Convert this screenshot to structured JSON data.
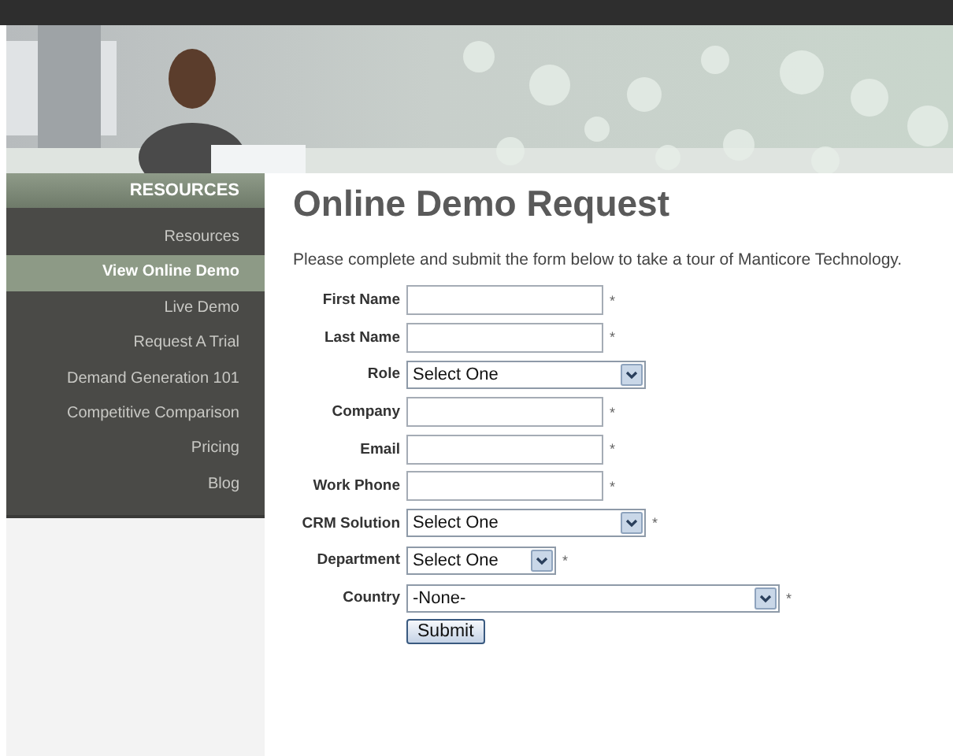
{
  "sidebar": {
    "heading": "RESOURCES",
    "items": [
      {
        "label": "Resources",
        "selected": false
      },
      {
        "label": "View Online Demo",
        "selected": true
      },
      {
        "label": "Live Demo",
        "selected": false
      },
      {
        "label": "Request A Trial",
        "selected": false
      },
      {
        "label": "Demand Generation 101",
        "selected": false
      },
      {
        "label": "Competitive Comparison",
        "selected": false
      },
      {
        "label": "Pricing",
        "selected": false
      },
      {
        "label": "Blog",
        "selected": false
      }
    ]
  },
  "main": {
    "title": "Online Demo Request",
    "intro": "Please complete and submit the form below to take a tour of Manticore Technology.",
    "fields": [
      {
        "label": "First Name",
        "kind": "text",
        "required": true
      },
      {
        "label": "Last Name",
        "kind": "text",
        "required": true
      },
      {
        "label": "Role",
        "kind": "select",
        "value": "Select One",
        "required": false
      },
      {
        "label": "Company",
        "kind": "text",
        "required": true
      },
      {
        "label": "Email",
        "kind": "text",
        "required": true
      },
      {
        "label": "Work Phone",
        "kind": "text",
        "required": true
      },
      {
        "label": "CRM Solution",
        "kind": "select",
        "value": "Select One",
        "required": true
      },
      {
        "label": "Department",
        "kind": "select",
        "value": "Select One",
        "required": true
      },
      {
        "label": "Country",
        "kind": "select",
        "value": "-None-",
        "required": true
      }
    ],
    "required_mark": "*",
    "submit": "Submit"
  }
}
